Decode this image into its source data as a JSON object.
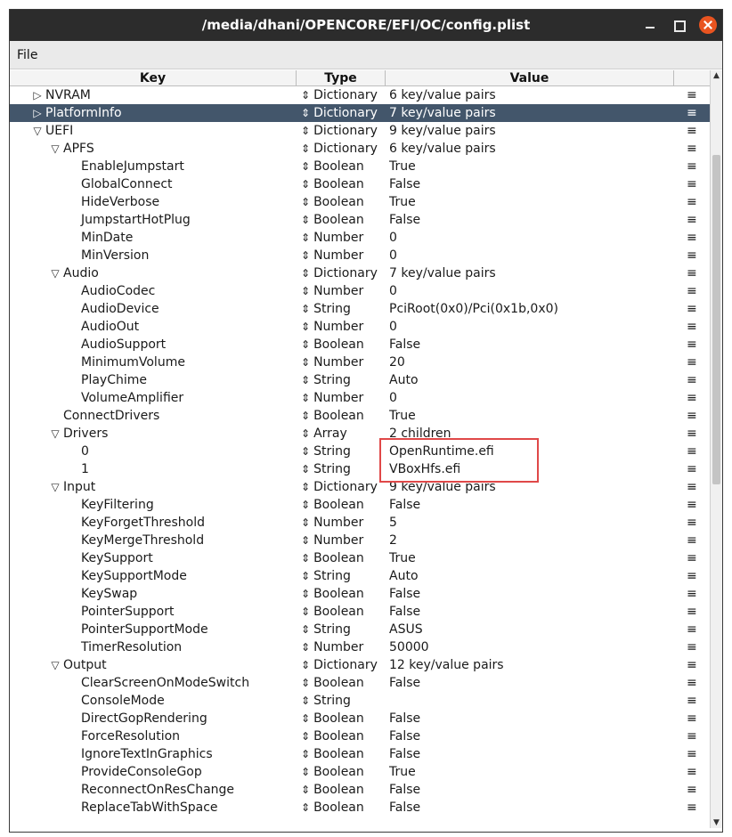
{
  "window": {
    "title": "/media/dhani/OPENCORE/EFI/OC/config.plist"
  },
  "menu": {
    "file": "File"
  },
  "columns": {
    "key": "Key",
    "type": "Type",
    "value": "Value"
  },
  "row_menu_glyph": "≡",
  "type_arrow_glyph": "⇕",
  "toggle": {
    "collapsed": "▷",
    "expanded": "▽"
  },
  "rows": [
    {
      "key": "NVRAM",
      "type": "Dictionary",
      "value": "6 key/value pairs",
      "toggle": "collapsed"
    },
    {
      "key": "PlatformInfo",
      "type": "Dictionary",
      "value": "7 key/value pairs",
      "toggle": "collapsed",
      "selected": true
    },
    {
      "key": "UEFI",
      "type": "Dictionary",
      "value": "9 key/value pairs",
      "toggle": "expanded"
    },
    {
      "key": "APFS",
      "type": "Dictionary",
      "value": "6 key/value pairs",
      "toggle": "expanded"
    },
    {
      "key": "EnableJumpstart",
      "type": "Boolean",
      "value": "True"
    },
    {
      "key": "GlobalConnect",
      "type": "Boolean",
      "value": "False"
    },
    {
      "key": "HideVerbose",
      "type": "Boolean",
      "value": "True"
    },
    {
      "key": "JumpstartHotPlug",
      "type": "Boolean",
      "value": "False"
    },
    {
      "key": "MinDate",
      "type": "Number",
      "value": "0"
    },
    {
      "key": "MinVersion",
      "type": "Number",
      "value": "0"
    },
    {
      "key": "Audio",
      "type": "Dictionary",
      "value": "7 key/value pairs",
      "toggle": "expanded"
    },
    {
      "key": "AudioCodec",
      "type": "Number",
      "value": "0"
    },
    {
      "key": "AudioDevice",
      "type": "String",
      "value": "PciRoot(0x0)/Pci(0x1b,0x0)"
    },
    {
      "key": "AudioOut",
      "type": "Number",
      "value": "0"
    },
    {
      "key": "AudioSupport",
      "type": "Boolean",
      "value": "False"
    },
    {
      "key": "MinimumVolume",
      "type": "Number",
      "value": "20"
    },
    {
      "key": "PlayChime",
      "type": "String",
      "value": "Auto"
    },
    {
      "key": "VolumeAmplifier",
      "type": "Number",
      "value": "0"
    },
    {
      "key": "ConnectDrivers",
      "type": "Boolean",
      "value": "True"
    },
    {
      "key": "Drivers",
      "type": "Array",
      "value": "2 children",
      "toggle": "expanded"
    },
    {
      "key": "0",
      "type": "String",
      "value": "OpenRuntime.efi"
    },
    {
      "key": "1",
      "type": "String",
      "value": "VBoxHfs.efi"
    },
    {
      "key": "Input",
      "type": "Dictionary",
      "value": "9 key/value pairs",
      "toggle": "expanded"
    },
    {
      "key": "KeyFiltering",
      "type": "Boolean",
      "value": "False"
    },
    {
      "key": "KeyForgetThreshold",
      "type": "Number",
      "value": "5"
    },
    {
      "key": "KeyMergeThreshold",
      "type": "Number",
      "value": "2"
    },
    {
      "key": "KeySupport",
      "type": "Boolean",
      "value": "True"
    },
    {
      "key": "KeySupportMode",
      "type": "String",
      "value": "Auto"
    },
    {
      "key": "KeySwap",
      "type": "Boolean",
      "value": "False"
    },
    {
      "key": "PointerSupport",
      "type": "Boolean",
      "value": "False"
    },
    {
      "key": "PointerSupportMode",
      "type": "String",
      "value": "ASUS"
    },
    {
      "key": "TimerResolution",
      "type": "Number",
      "value": "50000"
    },
    {
      "key": "Output",
      "type": "Dictionary",
      "value": "12 key/value pairs",
      "toggle": "expanded"
    },
    {
      "key": "ClearScreenOnModeSwitch",
      "type": "Boolean",
      "value": "False"
    },
    {
      "key": "ConsoleMode",
      "type": "String",
      "value": ""
    },
    {
      "key": "DirectGopRendering",
      "type": "Boolean",
      "value": "False"
    },
    {
      "key": "ForceResolution",
      "type": "Boolean",
      "value": "False"
    },
    {
      "key": "IgnoreTextInGraphics",
      "type": "Boolean",
      "value": "False"
    },
    {
      "key": "ProvideConsoleGop",
      "type": "Boolean",
      "value": "True"
    },
    {
      "key": "ReconnectOnResChange",
      "type": "Boolean",
      "value": "False"
    },
    {
      "key": "ReplaceTabWithSpace",
      "type": "Boolean",
      "value": "False"
    }
  ],
  "colors": {
    "selection": "#43566b",
    "highlight_box": "#e04848",
    "titlebar": "#2c2c2c",
    "close_button": "#e95420"
  }
}
